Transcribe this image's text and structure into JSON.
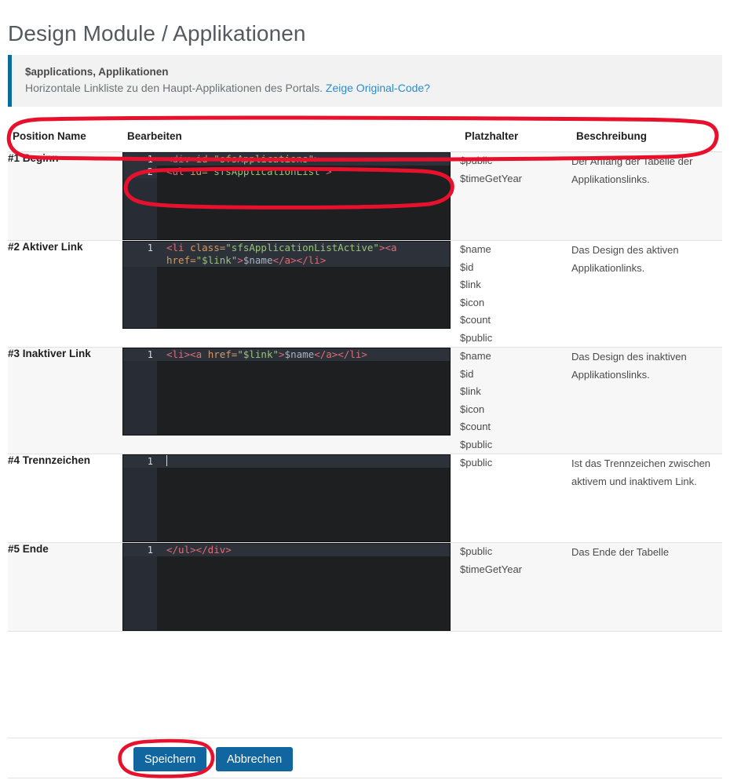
{
  "page": {
    "title": "Design Module / Applikationen"
  },
  "info": {
    "title": "$applications, Applikationen",
    "description": "Horizontale Linkliste zu den Haupt-Applikationen des Portals.",
    "link_label": "Zeige Original-Code?",
    "accent_color": "#0c6a9e",
    "background_color": "#f2f2f2"
  },
  "table": {
    "headers": {
      "position": "Position Name",
      "edit": "Bearbeiten",
      "placeholder": "Platzhalter",
      "description": "Beschreibung"
    },
    "rows": [
      {
        "position": "#1 Beginn",
        "code_lines": [
          {
            "number": "1",
            "foldable": true,
            "tokens": [
              {
                "t": "<div ",
                "c": "tk-tag"
              },
              {
                "t": "id=",
                "c": "tk-attr"
              },
              {
                "t": "\"sfsApplications\"",
                "c": "tk-str"
              },
              {
                "t": ">",
                "c": "tk-tag"
              }
            ]
          },
          {
            "number": "2",
            "foldable": true,
            "tokens": [
              {
                "t": "<ul ",
                "c": "tk-tag"
              },
              {
                "t": "id=",
                "c": "tk-attr"
              },
              {
                "t": "\"sfsApplicationList\"",
                "c": "tk-str"
              },
              {
                "t": ">",
                "c": "tk-tag"
              }
            ]
          }
        ],
        "placeholders": [
          "$public",
          "$timeGetYear"
        ],
        "description": "Der Anfang der Tabelle der Applikationslinks."
      },
      {
        "position": "#2 Aktiver Link",
        "code_lines": [
          {
            "number": "1",
            "foldable": false,
            "wrapped": true,
            "tokens": [
              {
                "t": "<li ",
                "c": "tk-tag"
              },
              {
                "t": "class=",
                "c": "tk-attr"
              },
              {
                "t": "\"sfsApplicationListActive\"",
                "c": "tk-str"
              },
              {
                "t": "><a ",
                "c": "tk-tag"
              },
              {
                "t": "href=",
                "c": "tk-attr"
              },
              {
                "t": "\"$link\"",
                "c": "tk-str"
              },
              {
                "t": ">",
                "c": "tk-tag"
              },
              {
                "t": "$name",
                "c": "tk-text"
              },
              {
                "t": "</a></li>",
                "c": "tk-tag"
              }
            ]
          }
        ],
        "placeholders": [
          "$name",
          "$id",
          "$link",
          "$icon",
          "$count",
          "$public"
        ],
        "description": "Das Design des aktiven Applikationlinks."
      },
      {
        "position": "#3 Inaktiver Link",
        "code_lines": [
          {
            "number": "1",
            "foldable": false,
            "tokens": [
              {
                "t": "<li><a ",
                "c": "tk-tag"
              },
              {
                "t": "href=",
                "c": "tk-attr"
              },
              {
                "t": "\"$link\"",
                "c": "tk-str"
              },
              {
                "t": ">",
                "c": "tk-tag"
              },
              {
                "t": "$name",
                "c": "tk-text"
              },
              {
                "t": "</a></li>",
                "c": "tk-tag"
              }
            ]
          }
        ],
        "placeholders": [
          "$name",
          "$id",
          "$link",
          "$icon",
          "$count",
          "$public"
        ],
        "description": "Das Design des inaktiven Applikationslinks."
      },
      {
        "position": "#4 Trennzeichen",
        "code_lines": [
          {
            "number": "1",
            "foldable": false,
            "caret": true,
            "tokens": []
          }
        ],
        "placeholders": [
          "$public"
        ],
        "description": "Ist das Trennzeichen zwischen aktivem und inaktivem Link."
      },
      {
        "position": "#5 Ende",
        "code_lines": [
          {
            "number": "1",
            "foldable": false,
            "tokens": [
              {
                "t": "</ul></div>",
                "c": "tk-tag"
              }
            ]
          }
        ],
        "placeholders": [
          "$public",
          "$timeGetYear"
        ],
        "description": "Das Ende der Tabelle"
      }
    ]
  },
  "footer": {
    "save_label": "Speichern",
    "cancel_label": "Abbrechen",
    "button_color": "#1266a0"
  },
  "annotations": {
    "color": "#e8112d",
    "items": [
      {
        "name": "header-row-ellipse"
      },
      {
        "name": "code-first-lines-ellipse"
      },
      {
        "name": "save-button-ellipse"
      }
    ]
  }
}
